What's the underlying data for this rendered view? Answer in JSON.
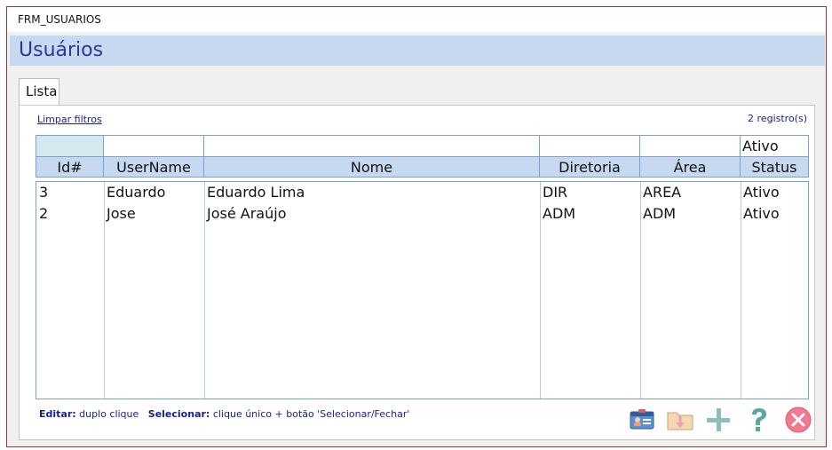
{
  "form": {
    "name": "FRM_USUARIOS",
    "title": "Usuários"
  },
  "tabs": [
    {
      "label": "Lista"
    }
  ],
  "toolbar": {
    "clear_filters": "Limpar filtros",
    "record_count": "2 registro(s)"
  },
  "filters": {
    "id": "",
    "username": "",
    "nome": "",
    "diretoria": "",
    "area": "",
    "status": "Ativo"
  },
  "columns": [
    "Id#",
    "UserName",
    "Nome",
    "Diretoria",
    "Área",
    "Status"
  ],
  "rows": [
    {
      "id": "3",
      "username": "Eduardo",
      "nome": "Eduardo Lima",
      "diretoria": "DIR",
      "area": "AREA",
      "status": "Ativo"
    },
    {
      "id": "2",
      "username": "Jose",
      "nome": "José Araújo",
      "diretoria": "ADM",
      "area": "ADM",
      "status": "Ativo"
    }
  ],
  "hint": {
    "edit_label": "Editar:",
    "edit_text": "duplo clique",
    "select_label": "Selecionar:",
    "select_text": "clique único + botão 'Selecionar/Fechar'"
  },
  "actions": [
    {
      "icon": "id-card-icon"
    },
    {
      "icon": "folder-download-icon"
    },
    {
      "icon": "plus-icon"
    },
    {
      "icon": "help-icon"
    },
    {
      "icon": "close-icon"
    }
  ],
  "colors": {
    "accent": "#c6d9f1",
    "title": "#2f3699",
    "link": "#1a1f8a",
    "border": "#a03040"
  }
}
